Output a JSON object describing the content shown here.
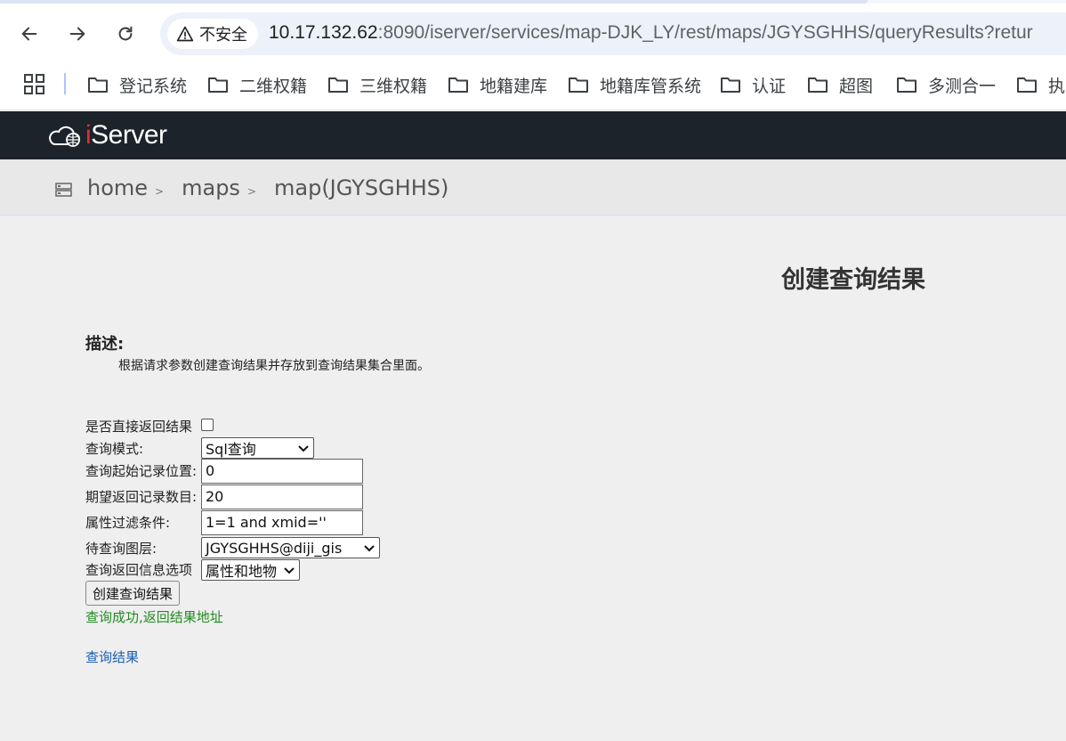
{
  "browser": {
    "security_label": "不安全",
    "url_host": "10.17.132.62",
    "url_rest": ":8090/iserver/services/map-DJK_LY/rest/maps/JGYSGHHS/queryResults?retur",
    "bookmarks": [
      {
        "label": "登记系统",
        "icon": "folder-icon"
      },
      {
        "label": "二维权籍",
        "icon": "folder-icon"
      },
      {
        "label": "三维权籍",
        "icon": "folder-icon"
      },
      {
        "label": "地籍建库",
        "icon": "folder-icon"
      },
      {
        "label": "地籍库管系统",
        "icon": "folder-icon"
      },
      {
        "label": "认证",
        "icon": "folder-icon"
      },
      {
        "label": "超图",
        "icon": "folder-icon"
      },
      {
        "label": "多测合一",
        "icon": "folder-icon"
      },
      {
        "label": "执",
        "icon": "folder-icon"
      }
    ]
  },
  "header": {
    "logo_i": "i",
    "logo_rest": "Server"
  },
  "breadcrumb": {
    "home": "home",
    "maps": "maps",
    "current": "map(JGYSGHHS)",
    "separator": ">"
  },
  "main": {
    "title": "创建查询结果",
    "description_heading": "描述:",
    "description_text": "根据请求参数创建查询结果并存放到查询结果集合里面。"
  },
  "form": {
    "return_direct_label": "是否直接返回结果",
    "return_direct_checked": false,
    "query_mode_label": "查询模式:",
    "query_mode_value": "Sql查询",
    "start_record_label": "查询起始记录位置:",
    "start_record_value": "0",
    "expect_count_label": "期望返回记录数目:",
    "expect_count_value": "20",
    "filter_label": "属性过滤条件:",
    "filter_value": "1=1 and xmid=''",
    "layer_label": "待查询图层:",
    "layer_value": "JGYSGHHS@diji_gis",
    "return_option_label": "查询返回信息选项",
    "return_option_value": "属性和地物",
    "submit_label": "创建查询结果",
    "success_message": "查询成功,返回结果地址",
    "result_link": "查询结果"
  },
  "colors": {
    "header_bg": "#1c232b",
    "success": "#228b22",
    "link": "#1a5fb4"
  }
}
